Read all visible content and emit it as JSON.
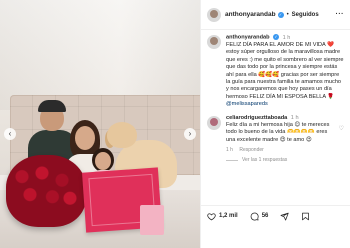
{
  "post": {
    "username": "anthonyarandab",
    "follow_label": "Seguidos",
    "more_label": "···"
  },
  "caption": {
    "username": "anthonyarandab",
    "time": "1 h",
    "text": "FELIZ DÍA PARA EL AMOR DE MI VIDA ❤️ estoy súper orgulloso de la maravillosa madre que eres :) me quito el sombrero al ver siempre que das todo por la princesa y siempre estás ahí para ella 🥰🥰🥰 gracias por ser siempre la guía para nuestra familia te amamos mucho y nos encargaremos que hoy pases un día hermoso FELIZ DÍA MI ESPOSA BELLA 🌹",
    "mention": "@melissapareds"
  },
  "comment": {
    "username": "celiarodriguezttaboada",
    "time": "1 h",
    "text": "Feliz día a mi hermosa hija 😊 te mereces todo lo bueno de la vida 🫶🫶🫶🫶 eres una excelente madre 😍 te amo 😍",
    "meta_time": "1 h",
    "meta_reply": "Responder",
    "replies_label": "Ver las 1 respuestas"
  },
  "actions": {
    "likes_count": "1,2 mil",
    "comments_count": "56",
    "likes_text": "",
    "date_text": ""
  },
  "icons": {
    "heart": "heart-icon",
    "comment": "comment-icon",
    "share": "share-icon",
    "bookmark": "bookmark-icon",
    "verified": "verified-badge-icon"
  },
  "colors": {
    "verified": "#3897f0",
    "mention": "#00376b",
    "muted": "#8e8e8e"
  }
}
